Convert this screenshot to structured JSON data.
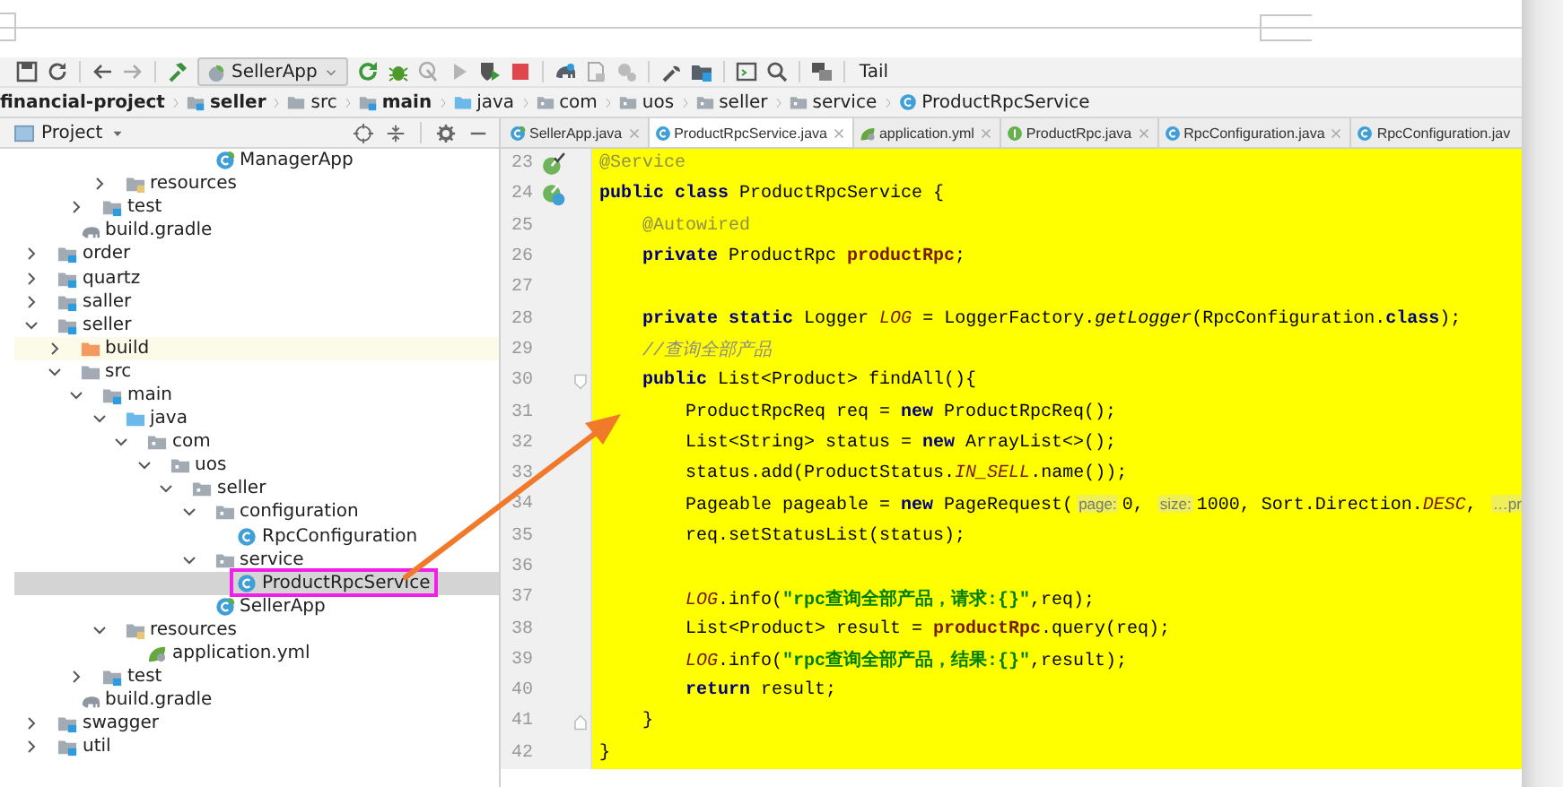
{
  "toolbar": {
    "run_config": "SellerApp",
    "tail": "Tail"
  },
  "breadcrumbs": [
    {
      "kind": "project",
      "label": "financial-project"
    },
    {
      "kind": "module",
      "label": "seller"
    },
    {
      "kind": "folder",
      "label": "src"
    },
    {
      "kind": "module",
      "label": "main"
    },
    {
      "kind": "source-folder",
      "label": "java"
    },
    {
      "kind": "package",
      "label": "com"
    },
    {
      "kind": "package",
      "label": "uos"
    },
    {
      "kind": "package",
      "label": "seller"
    },
    {
      "kind": "package",
      "label": "service"
    },
    {
      "kind": "class",
      "label": "ProductRpcService"
    }
  ],
  "project": {
    "title": "Project",
    "tree": [
      {
        "children": [
          {
            "children": [
              {
                "children": [
                  {
                    "children": [
                      {
                        "children": [
                          {
                            "children": [
                              {
                                "children": [
                                  {
                                    "kind": "spring-class",
                                    "label": "ManagerApp",
                                    "selected": false
                                  }
                                ]
                              }
                            ]
                          }
                        ]
                      }
                    ]
                  },
                  {
                    "kind": "resources-folder",
                    "label": "resources",
                    "expanded": false,
                    "selected": false
                  }
                ]
              },
              {
                "kind": "module",
                "label": "test",
                "expanded": false,
                "selected": false
              }
            ]
          },
          {
            "kind": "gradle",
            "label": "build.gradle",
            "selected": false
          }
        ]
      },
      {
        "kind": "module",
        "label": "order",
        "expanded": false,
        "selected": false
      },
      {
        "kind": "module",
        "label": "quartz",
        "expanded": false,
        "selected": false
      },
      {
        "kind": "module",
        "label": "saller",
        "expanded": false,
        "selected": false
      },
      {
        "kind": "module",
        "label": "seller",
        "expanded": true,
        "selected": false,
        "children": [
          {
            "kind": "excluded-folder",
            "label": "build",
            "expanded": false,
            "selected": false
          },
          {
            "kind": "folder",
            "label": "src",
            "expanded": true,
            "selected": false,
            "children": [
              {
                "kind": "module",
                "label": "main",
                "expanded": true,
                "selected": false,
                "children": [
                  {
                    "kind": "source-folder",
                    "label": "java",
                    "expanded": true,
                    "selected": false,
                    "children": [
                      {
                        "kind": "package",
                        "label": "com",
                        "expanded": true,
                        "selected": false,
                        "children": [
                          {
                            "kind": "package",
                            "label": "uos",
                            "expanded": true,
                            "selected": false,
                            "children": [
                              {
                                "kind": "package",
                                "label": "seller",
                                "expanded": true,
                                "selected": false,
                                "children": [
                                  {
                                    "kind": "package",
                                    "label": "configuration",
                                    "expanded": true,
                                    "selected": false,
                                    "children": [
                                      {
                                        "kind": "class",
                                        "label": "RpcConfiguration",
                                        "selected": false
                                      }
                                    ]
                                  },
                                  {
                                    "kind": "package",
                                    "label": "service",
                                    "expanded": true,
                                    "selected": false,
                                    "children": [
                                      {
                                        "kind": "class",
                                        "label": "ProductRpcService",
                                        "selected": true
                                      }
                                    ]
                                  },
                                  {
                                    "kind": "spring-class",
                                    "label": "SellerApp",
                                    "selected": false
                                  }
                                ]
                              }
                            ]
                          }
                        ]
                      }
                    ]
                  },
                  {
                    "kind": "resources-folder",
                    "label": "resources",
                    "expanded": true,
                    "selected": false,
                    "children": [
                      {
                        "kind": "yml",
                        "label": "application.yml",
                        "selected": false
                      }
                    ]
                  }
                ]
              },
              {
                "kind": "module",
                "label": "test",
                "expanded": false,
                "selected": false
              }
            ]
          },
          {
            "kind": "gradle",
            "label": "build.gradle",
            "selected": false
          }
        ]
      },
      {
        "kind": "module",
        "label": "swagger",
        "expanded": false,
        "selected": false
      },
      {
        "kind": "module",
        "label": "util",
        "expanded": false,
        "selected": false
      }
    ]
  },
  "tabs": [
    {
      "kind": "spring-class",
      "label": "SellerApp.java",
      "selected": false,
      "closable": true
    },
    {
      "kind": "class",
      "label": "ProductRpcService.java",
      "selected": true,
      "closable": true
    },
    {
      "kind": "yml",
      "label": "application.yml",
      "selected": false,
      "closable": true
    },
    {
      "kind": "interface",
      "label": "ProductRpc.java",
      "selected": false,
      "closable": true
    },
    {
      "kind": "class",
      "label": "RpcConfiguration.java",
      "selected": false,
      "closable": true
    },
    {
      "kind": "class",
      "label": "RpcConfiguration.jav",
      "selected": false,
      "closable": false
    }
  ],
  "code": [
    {
      "number": "23",
      "kind": "bean-check",
      "tokens": [
        {
          "kind": "annotation",
          "text": "@Service"
        }
      ]
    },
    {
      "number": "24",
      "kind": "bean-class",
      "tokens": [
        {
          "kind": "keyword",
          "text": "public class "
        },
        {
          "kind": "plain",
          "text": "ProductRpcService {"
        }
      ]
    },
    {
      "number": "25",
      "kind": "plain",
      "tokens": [
        {
          "kind": "annotation",
          "text": "    @Autowired"
        }
      ]
    },
    {
      "number": "26",
      "kind": "plain",
      "tokens": [
        {
          "kind": "keyword",
          "text": "    private "
        },
        {
          "kind": "plain",
          "text": "ProductRpc "
        },
        {
          "kind": "field",
          "text": "productRpc"
        },
        {
          "kind": "plain",
          "text": ";"
        }
      ]
    },
    {
      "number": "27",
      "kind": "plain"
    },
    {
      "number": "28",
      "kind": "plain",
      "tokens": [
        {
          "kind": "keyword",
          "text": "    private static "
        },
        {
          "kind": "plain",
          "text": "Logger "
        },
        {
          "kind": "static",
          "text": "LOG"
        },
        {
          "kind": "plain",
          "text": " = LoggerFactory."
        },
        {
          "kind": "method",
          "text": "getLogger"
        },
        {
          "kind": "plain",
          "text": "(RpcConfiguration."
        },
        {
          "kind": "keyword",
          "text": "class"
        },
        {
          "kind": "plain",
          "text": ");"
        }
      ]
    },
    {
      "number": "29",
      "kind": "plain",
      "tokens": [
        {
          "kind": "comment",
          "text": "    //查询全部产品"
        }
      ]
    },
    {
      "number": "30",
      "kind": "fold-start",
      "tokens": [
        {
          "kind": "keyword",
          "text": "    public "
        },
        {
          "kind": "plain",
          "text": "List<Product> findAll(){"
        }
      ]
    },
    {
      "number": "31",
      "kind": "plain",
      "tokens": [
        {
          "kind": "plain",
          "text": "        ProductRpcReq req = "
        },
        {
          "kind": "keyword",
          "text": "new "
        },
        {
          "kind": "plain",
          "text": "ProductRpcReq();"
        }
      ]
    },
    {
      "number": "32",
      "kind": "plain",
      "tokens": [
        {
          "kind": "plain",
          "text": "        List<String> status = "
        },
        {
          "kind": "keyword",
          "text": "new "
        },
        {
          "kind": "plain",
          "text": "ArrayList<>();"
        }
      ]
    },
    {
      "number": "33",
      "kind": "plain",
      "tokens": [
        {
          "kind": "plain",
          "text": "        status.add(ProductStatus."
        },
        {
          "kind": "static",
          "text": "IN_SELL"
        },
        {
          "kind": "plain",
          "text": ".name());"
        }
      ]
    },
    {
      "number": "34",
      "kind": "plain",
      "tokens": [
        {
          "kind": "plain",
          "text": "        Pageable pageable = "
        },
        {
          "kind": "keyword",
          "text": "new "
        },
        {
          "kind": "plain",
          "text": "PageRequest("
        },
        {
          "kind": "hint",
          "text": "page:"
        },
        {
          "kind": "plain",
          "text": "0, "
        },
        {
          "kind": "hint",
          "text": "size:"
        },
        {
          "kind": "plain",
          "text": "1000, Sort.Direction."
        },
        {
          "kind": "static",
          "text": "DESC"
        },
        {
          "kind": "plain",
          "text": ", "
        },
        {
          "kind": "hint",
          "text": "…pr"
        }
      ]
    },
    {
      "number": "35",
      "kind": "plain",
      "tokens": [
        {
          "kind": "plain",
          "text": "        req.setStatusList(status);"
        }
      ]
    },
    {
      "number": "36",
      "kind": "plain"
    },
    {
      "number": "37",
      "kind": "plain",
      "tokens": [
        {
          "kind": "static",
          "text": "        LOG"
        },
        {
          "kind": "plain",
          "text": ".info("
        },
        {
          "kind": "string",
          "text": "\"rpc查询全部产品，请求:{}\""
        },
        {
          "kind": "plain",
          "text": ",req);"
        }
      ]
    },
    {
      "number": "38",
      "kind": "plain",
      "tokens": [
        {
          "kind": "plain",
          "text": "        List<Product> result = "
        },
        {
          "kind": "field",
          "text": "productRpc"
        },
        {
          "kind": "plain",
          "text": ".query(req);"
        }
      ]
    },
    {
      "number": "39",
      "kind": "plain",
      "tokens": [
        {
          "kind": "static",
          "text": "        LOG"
        },
        {
          "kind": "plain",
          "text": ".info("
        },
        {
          "kind": "string",
          "text": "\"rpc查询全部产品，结果:{}\""
        },
        {
          "kind": "plain",
          "text": ",result);"
        }
      ]
    },
    {
      "number": "40",
      "kind": "plain",
      "tokens": [
        {
          "kind": "keyword",
          "text": "        return "
        },
        {
          "kind": "plain",
          "text": "result;"
        }
      ]
    },
    {
      "number": "41",
      "kind": "fold-end",
      "tokens": [
        {
          "kind": "plain",
          "text": "    }"
        }
      ]
    },
    {
      "number": "42",
      "kind": "plain",
      "tokens": [
        {
          "kind": "plain",
          "text": "}"
        }
      ]
    }
  ]
}
